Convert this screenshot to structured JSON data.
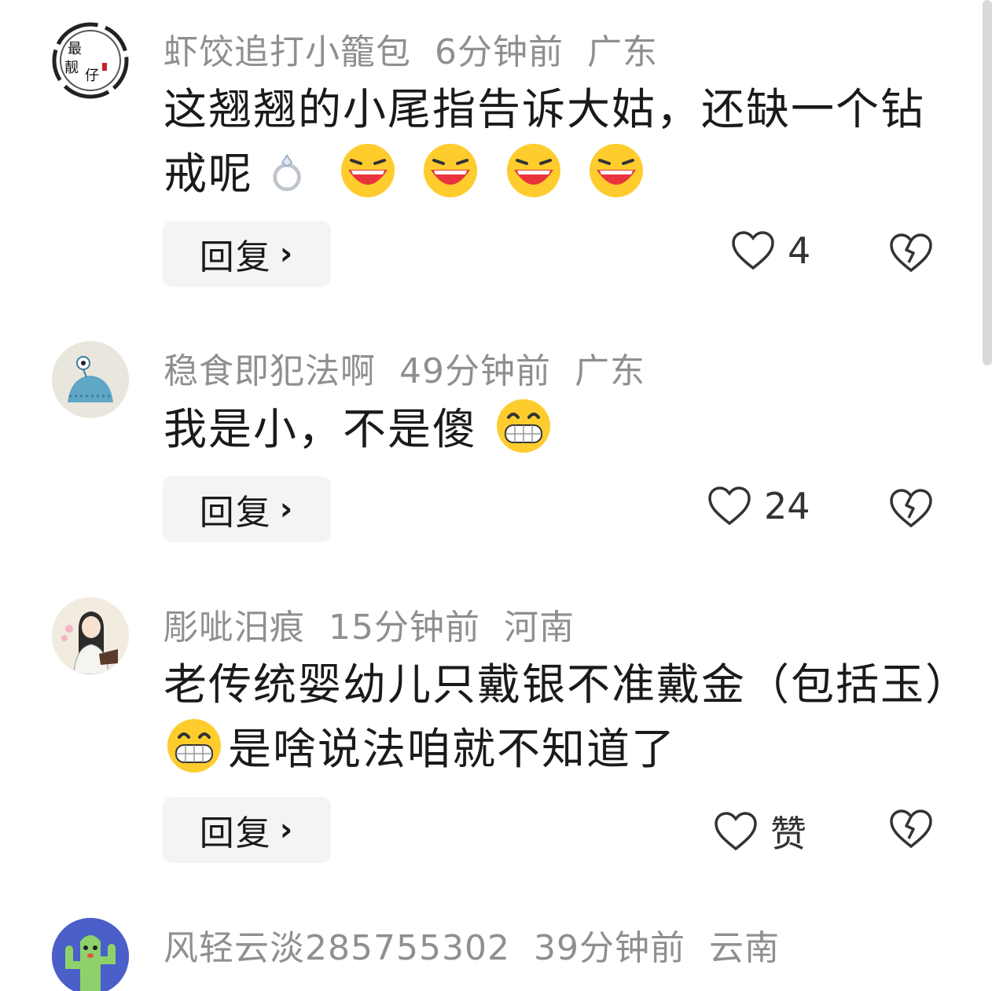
{
  "comments": [
    {
      "user": "虾饺追打小籠包",
      "time": "6分钟前",
      "location": "广东",
      "text_line1": "这翘翘的小尾指告诉大姑，还缺一个钻",
      "text_line2": "戒呢",
      "emojis": [
        "ring",
        "laughing",
        "laughing",
        "laughing",
        "laughing"
      ],
      "avatar_text": "最靓仔",
      "reply_label": "回复",
      "likes": "4"
    },
    {
      "user": "稳食即犯法啊",
      "time": "49分钟前",
      "location": "广东",
      "text_line1": "我是小，不是傻",
      "emojis": [
        "grin"
      ],
      "reply_label": "回复",
      "likes": "24"
    },
    {
      "user": "彫呲汨痕",
      "time": "15分钟前",
      "location": "河南",
      "text_line1": "老传统婴幼儿只戴银不准戴金（包括玉）",
      "text_line2": "是啥说法咱就不知道了",
      "emojis": [
        "grin"
      ],
      "reply_label": "回复",
      "likes": "赞"
    },
    {
      "user": "风轻云淡285755302",
      "time": "39分钟前",
      "location": "云南"
    }
  ],
  "icons": {
    "like": "heart-outline-icon",
    "dislike": "broken-heart-icon",
    "chevron": "chevron-right-icon"
  },
  "colors": {
    "meta_text": "#8f8f8f",
    "reply_bg": "#f3f4f5",
    "emoji_face": "#ffcc2e",
    "emoji_mouth": "#e8353b"
  }
}
